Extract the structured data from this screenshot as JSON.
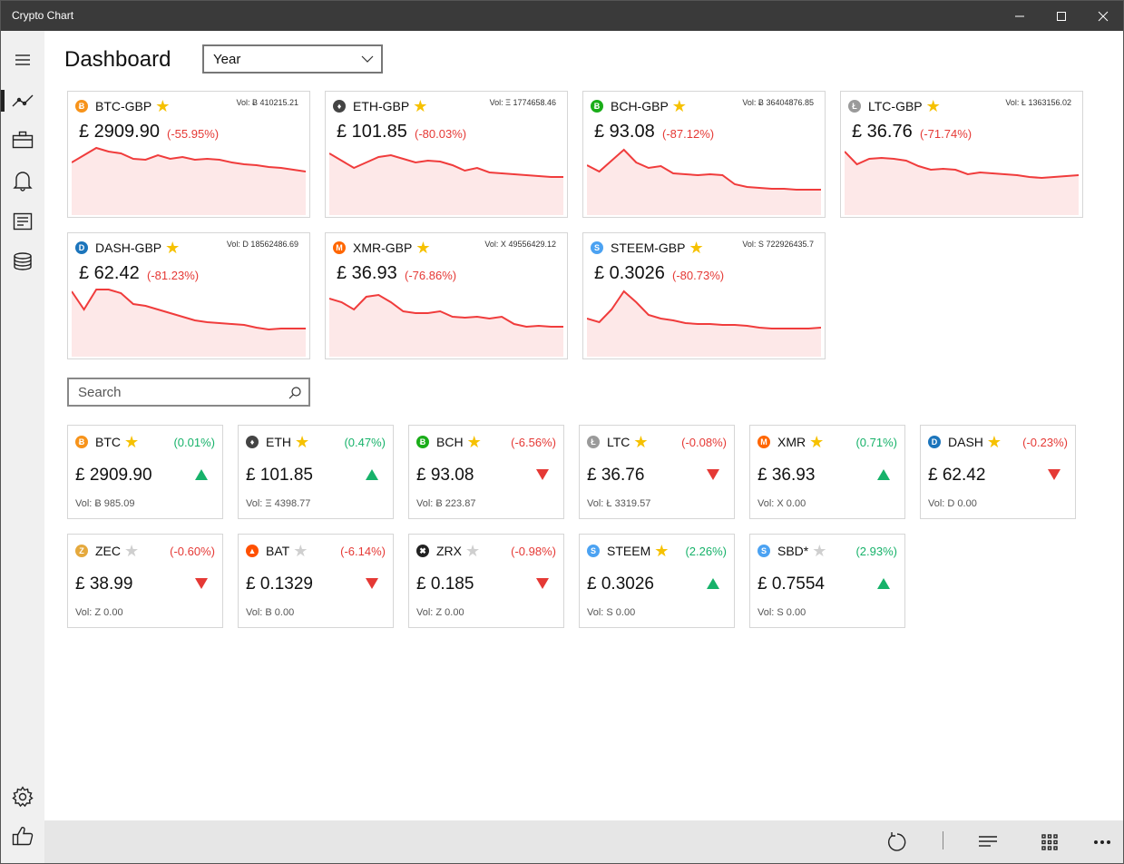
{
  "window": {
    "title": "Crypto Chart"
  },
  "header": {
    "title": "Dashboard",
    "range": "Year"
  },
  "search": {
    "placeholder": "Search"
  },
  "favorites": [
    {
      "pair": "BTC-GBP",
      "vol": "Vol: Ƀ 410215.21",
      "price": "£ 2909.90",
      "change": "(-55.95%)",
      "icon": "bitcoin-icon",
      "color": "#f7931a",
      "series": [
        58,
        66,
        74,
        70,
        68,
        62,
        61,
        66,
        62,
        64,
        61,
        62,
        61,
        58,
        56,
        55,
        53,
        52,
        50,
        48
      ]
    },
    {
      "pair": "ETH-GBP",
      "vol": "Vol: Ξ 1774658.46",
      "price": "£ 101.85",
      "change": "(-80.03%)",
      "icon": "ethereum-icon",
      "color": "#444444",
      "series": [
        68,
        60,
        52,
        58,
        64,
        66,
        62,
        58,
        60,
        59,
        55,
        49,
        52,
        47,
        46,
        45,
        44,
        43,
        42,
        42
      ]
    },
    {
      "pair": "BCH-GBP",
      "vol": "Vol: Ƀ 36404876.85",
      "price": "£ 93.08",
      "change": "(-87.12%)",
      "icon": "bitcoin-cash-icon",
      "color": "#1aad19",
      "series": [
        55,
        48,
        60,
        72,
        58,
        52,
        54,
        46,
        45,
        44,
        45,
        44,
        34,
        31,
        30,
        29,
        29,
        28,
        28,
        28
      ]
    },
    {
      "pair": "LTC-GBP",
      "vol": "Vol: Ł 1363156.02",
      "price": "£ 36.76",
      "change": "(-71.74%)",
      "icon": "litecoin-icon",
      "color": "#9a9a9a",
      "series": [
        70,
        56,
        62,
        63,
        62,
        60,
        54,
        50,
        51,
        50,
        45,
        47,
        46,
        45,
        44,
        42,
        41,
        42,
        43,
        44
      ]
    },
    {
      "pair": "DASH-GBP",
      "vol": "Vol: D 18562486.69",
      "price": "£ 62.42",
      "change": "(-81.23%)",
      "icon": "dash-icon",
      "color": "#1c75bc",
      "series": [
        72,
        52,
        74,
        74,
        70,
        58,
        56,
        52,
        48,
        44,
        40,
        38,
        37,
        36,
        35,
        32,
        30,
        31,
        31,
        31
      ]
    },
    {
      "pair": "XMR-GBP",
      "vol": "Vol: X 49556429.12",
      "price": "£ 36.93",
      "change": "(-76.86%)",
      "icon": "monero-icon",
      "color": "#ff6600",
      "series": [
        64,
        60,
        52,
        66,
        68,
        60,
        50,
        48,
        48,
        50,
        44,
        43,
        44,
        42,
        44,
        36,
        33,
        34,
        33,
        33
      ]
    },
    {
      "pair": "STEEM-GBP",
      "vol": "Vol: S 722926435.7",
      "price": "£ 0.3026",
      "change": "(-80.73%)",
      "icon": "steem-icon",
      "color": "#4ba2f2",
      "series": [
        42,
        38,
        52,
        72,
        60,
        46,
        42,
        40,
        37,
        36,
        36,
        35,
        35,
        34,
        32,
        31,
        31,
        31,
        31,
        32
      ]
    }
  ],
  "coins": [
    {
      "symbol": "BTC",
      "fav": true,
      "change": "(0.01%)",
      "up": true,
      "price": "£ 2909.90",
      "vol": "Vol: Ƀ 985.09",
      "icon": "bitcoin-icon",
      "color": "#f7931a"
    },
    {
      "symbol": "ETH",
      "fav": true,
      "change": "(0.47%)",
      "up": true,
      "price": "£ 101.85",
      "vol": "Vol: Ξ 4398.77",
      "icon": "ethereum-icon",
      "color": "#444444"
    },
    {
      "symbol": "BCH",
      "fav": true,
      "change": "(-6.56%)",
      "up": false,
      "price": "£ 93.08",
      "vol": "Vol: Ƀ 223.87",
      "icon": "bitcoin-cash-icon",
      "color": "#1aad19"
    },
    {
      "symbol": "LTC",
      "fav": true,
      "change": "(-0.08%)",
      "up": false,
      "price": "£ 36.76",
      "vol": "Vol: Ł 3319.57",
      "icon": "litecoin-icon",
      "color": "#9a9a9a"
    },
    {
      "symbol": "XMR",
      "fav": true,
      "change": "(0.71%)",
      "up": true,
      "price": "£ 36.93",
      "vol": "Vol: X 0.00",
      "icon": "monero-icon",
      "color": "#ff6600"
    },
    {
      "symbol": "DASH",
      "fav": true,
      "change": "(-0.23%)",
      "up": false,
      "price": "£ 62.42",
      "vol": "Vol: D 0.00",
      "icon": "dash-icon",
      "color": "#1c75bc"
    },
    {
      "symbol": "ZEC",
      "fav": false,
      "change": "(-0.60%)",
      "up": false,
      "price": "£ 38.99",
      "vol": "Vol: Z 0.00",
      "icon": "zcash-icon",
      "color": "#e5a93d"
    },
    {
      "symbol": "BAT",
      "fav": false,
      "change": "(-6.14%)",
      "up": false,
      "price": "£ 0.1329",
      "vol": "Vol: B 0.00",
      "icon": "bat-icon",
      "color": "#ff5000"
    },
    {
      "symbol": "ZRX",
      "fav": false,
      "change": "(-0.98%)",
      "up": false,
      "price": "£ 0.185",
      "vol": "Vol: Z 0.00",
      "icon": "zrx-icon",
      "color": "#222222"
    },
    {
      "symbol": "STEEM",
      "fav": true,
      "change": "(2.26%)",
      "up": true,
      "price": "£ 0.3026",
      "vol": "Vol: S 0.00",
      "icon": "steem-icon",
      "color": "#4ba2f2"
    },
    {
      "symbol": "SBD*",
      "fav": false,
      "change": "(2.93%)",
      "up": true,
      "price": "£ 0.7554",
      "vol": "Vol: S 0.00",
      "icon": "steem-icon",
      "color": "#4ba2f2"
    }
  ]
}
